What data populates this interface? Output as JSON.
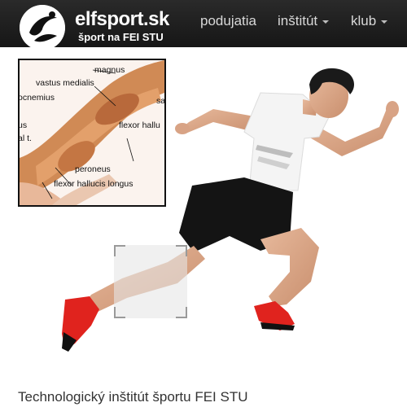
{
  "navbar": {
    "brand": "elfsport.sk",
    "tagline": "šport na FEI STU",
    "items": [
      {
        "label": "podujatia",
        "dropdown": false
      },
      {
        "label": "inštitút",
        "dropdown": true
      },
      {
        "label": "klub",
        "dropdown": true
      }
    ]
  },
  "hero": {
    "anatomy_labels": {
      "l1": "magnus",
      "l2": "vastus medialis",
      "l3": "ocnemius",
      "l4": "sa",
      "l5": "flexor hallu",
      "l6": "us",
      "l7": "al t.",
      "l8": "peroneus",
      "l9": "flexor hallucis longus"
    }
  },
  "page": {
    "title": "Technologický inštitút športu FEI STU"
  },
  "colors": {
    "navbar": "#1b1b1b",
    "shoe_red": "#e0231e",
    "muscle": "#d08a55"
  }
}
